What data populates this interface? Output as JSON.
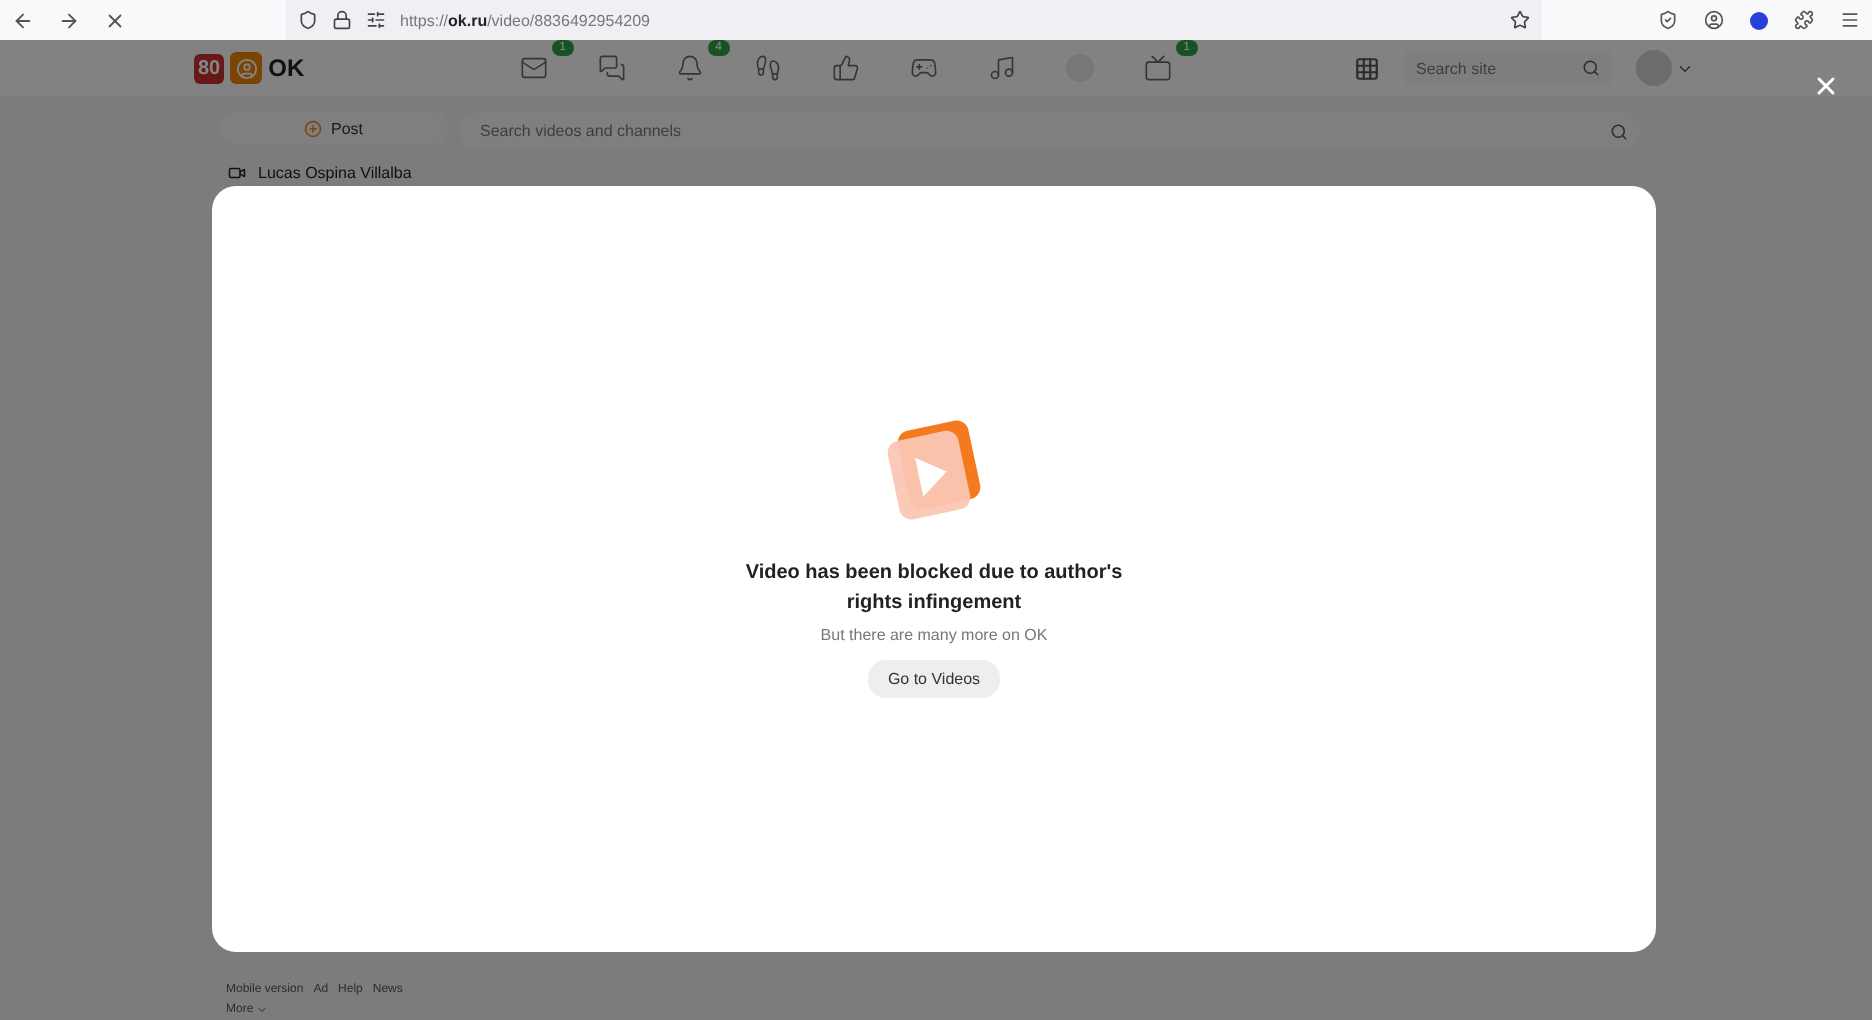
{
  "browser": {
    "url": "https://**ok.ru**/video/8836492954209"
  },
  "header": {
    "logo_badge": "80",
    "logo_text": "OK",
    "nav": [
      {
        "kind": "mail",
        "badge": "1"
      },
      {
        "kind": "chat"
      },
      {
        "kind": "bell",
        "badge": "4"
      },
      {
        "kind": "steps"
      },
      {
        "kind": "like"
      },
      {
        "kind": "games"
      },
      {
        "kind": "music"
      },
      {
        "kind": "dot"
      },
      {
        "kind": "tv",
        "badge": "1"
      }
    ],
    "search": {
      "placeholder": "Search site"
    }
  },
  "sidebar": {
    "post_button": "Post",
    "items": [
      {
        "label": "Lucas Ospina Villalba"
      }
    ]
  },
  "video_search": {
    "placeholder": "Search videos and channels"
  },
  "footer": {
    "links": [
      "Mobile version",
      "Ad",
      "Help",
      "News"
    ],
    "more": "More"
  },
  "modal": {
    "title": "Video has been blocked due to author's rights infingement",
    "subtitle": "But there are many more on OK",
    "button": "Go to Videos"
  }
}
